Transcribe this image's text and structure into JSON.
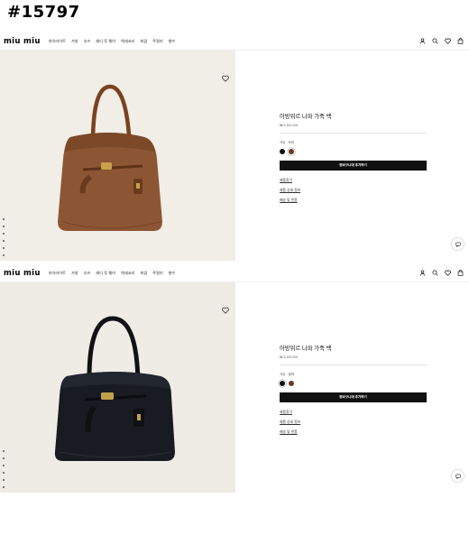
{
  "title_tag": "#15797",
  "brand": {
    "logo": "miu miu"
  },
  "nav": {
    "menu": [
      "하이라이트",
      "가방",
      "슈즈",
      "레디 투 웨어",
      "액세서리",
      "피겹",
      "주얼리",
      "향수"
    ],
    "icons": [
      "user-icon",
      "search-icon",
      "heart-icon",
      "bag-icon"
    ]
  },
  "products": [
    {
      "name": "아방뛰르 나파 가죽 백",
      "price": "₩ 5,200,000",
      "color_label": "색상 : 토퍼",
      "swatches": [
        "#111111",
        "#6b3c22"
      ],
      "cart_label": "장바구니에 추가하기",
      "links": [
        "제품찾기",
        "제품 상세 정보",
        "배송 및 반품"
      ],
      "bag_color": "brown-suede"
    },
    {
      "name": "아방뛰르 나파 가죽 백",
      "price": "₩ 5,200,000",
      "color_label": "색상 : 블랙",
      "swatches": [
        "#111111",
        "#6b3c22"
      ],
      "cart_label": "장바구니에 추가하기",
      "links": [
        "제품찾기",
        "제품 상세 정보",
        "배송 및 반품"
      ],
      "bag_color": "black-leather"
    }
  ],
  "colors": {
    "accent": "#111111",
    "brown_bag": "#8a5330",
    "black_bag": "#14161c"
  }
}
